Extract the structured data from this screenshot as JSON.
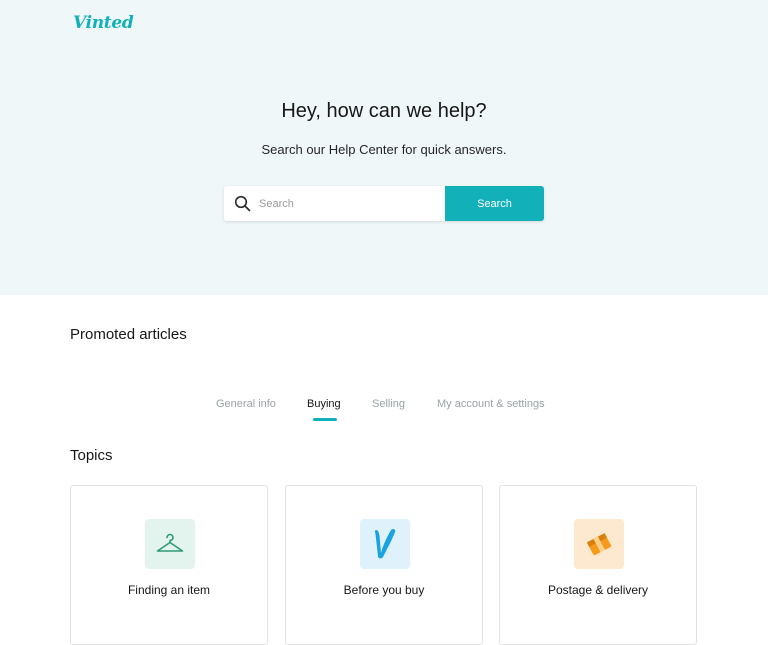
{
  "brand": {
    "name": "Vinted",
    "accent_color": "#12b0b8"
  },
  "hero": {
    "title": "Hey, how can we help?",
    "subtitle": "Search our Help Center for quick answers.",
    "search": {
      "placeholder": "Search",
      "value": "",
      "button_label": "Search",
      "icon": "search-icon"
    }
  },
  "promoted": {
    "heading": "Promoted articles",
    "tabs": [
      {
        "label": "General info",
        "active": false
      },
      {
        "label": "Buying",
        "active": true
      },
      {
        "label": "Selling",
        "active": false
      },
      {
        "label": "My account & settings",
        "active": false
      }
    ]
  },
  "topics": {
    "heading": "Topics",
    "cards": [
      {
        "label": "Finding an item",
        "icon": "hanger-icon",
        "icon_bg": "#e3f4ee",
        "icon_color": "#2f9a76"
      },
      {
        "label": "Before you buy",
        "icon": "vinted-v-icon",
        "icon_bg": "#dff1fa",
        "icon_color": "#19a3e0"
      },
      {
        "label": "Postage & delivery",
        "icon": "package-icon",
        "icon_bg": "#fde9cf",
        "icon_color": "#f59a1b"
      }
    ]
  }
}
